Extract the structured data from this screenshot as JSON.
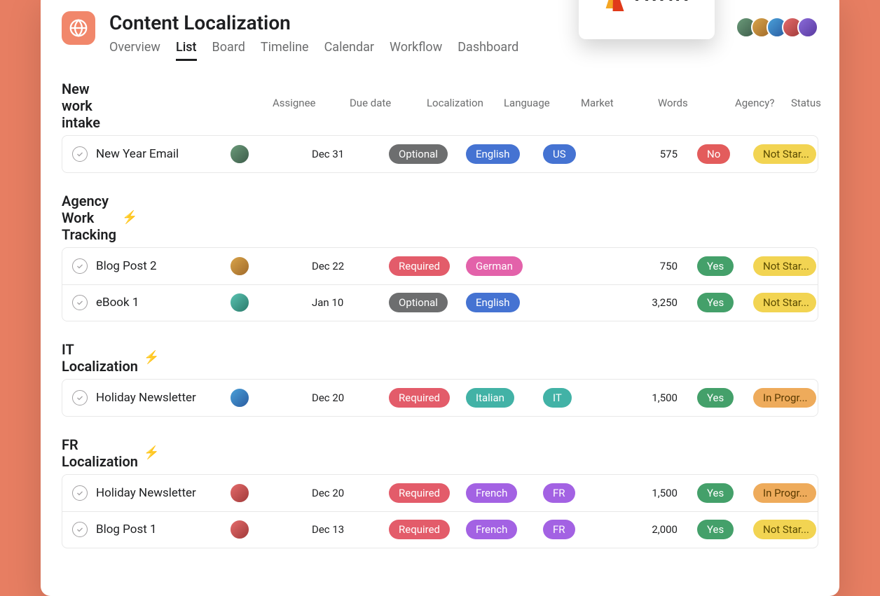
{
  "brand": {
    "name": "AWIN"
  },
  "project": {
    "title": "Content Localization",
    "tabs": [
      "Overview",
      "List",
      "Board",
      "Timeline",
      "Calendar",
      "Workflow",
      "Dashboard"
    ],
    "active_tab": "List"
  },
  "columns": [
    "Assignee",
    "Due date",
    "Localization",
    "Language",
    "Market",
    "Words",
    "Agency?",
    "Status"
  ],
  "sections": [
    {
      "title": "New work intake",
      "bolt": false,
      "tasks": [
        {
          "name": "New Year Email",
          "assignee_class": "a1",
          "due": "Dec 31",
          "localization": {
            "label": "Optional",
            "color": "dark"
          },
          "language": {
            "label": "English",
            "color": "blue"
          },
          "market": {
            "label": "US",
            "color": "blue"
          },
          "words": "575",
          "agency": {
            "label": "No",
            "color": "redno"
          },
          "status": {
            "label": "Not Star...",
            "color": "yellow"
          }
        }
      ]
    },
    {
      "title": "Agency Work Tracking",
      "bolt": true,
      "tasks": [
        {
          "name": "Blog Post 2",
          "assignee_class": "a2",
          "due": "Dec 22",
          "localization": {
            "label": "Required",
            "color": "red"
          },
          "language": {
            "label": "German",
            "color": "pink"
          },
          "market": null,
          "words": "750",
          "agency": {
            "label": "Yes",
            "color": "green"
          },
          "status": {
            "label": "Not Star...",
            "color": "yellow"
          }
        },
        {
          "name": "eBook 1",
          "assignee_class": "a6",
          "due": "Jan 10",
          "localization": {
            "label": "Optional",
            "color": "dark"
          },
          "language": {
            "label": "English",
            "color": "blue"
          },
          "market": null,
          "words": "3,250",
          "agency": {
            "label": "Yes",
            "color": "green"
          },
          "status": {
            "label": "Not Star...",
            "color": "yellow"
          }
        }
      ]
    },
    {
      "title": "IT Localization",
      "bolt": true,
      "tasks": [
        {
          "name": "Holiday Newsletter",
          "assignee_class": "a3",
          "due": "Dec 20",
          "localization": {
            "label": "Required",
            "color": "red"
          },
          "language": {
            "label": "Italian",
            "color": "teal"
          },
          "market": {
            "label": "IT",
            "color": "teal"
          },
          "words": "1,500",
          "agency": {
            "label": "Yes",
            "color": "green"
          },
          "status": {
            "label": "In Progr...",
            "color": "orange"
          }
        }
      ]
    },
    {
      "title": "FR Localization",
      "bolt": true,
      "tasks": [
        {
          "name": "Holiday Newsletter",
          "assignee_class": "a4",
          "due": "Dec 20",
          "localization": {
            "label": "Required",
            "color": "red"
          },
          "language": {
            "label": "French",
            "color": "purple"
          },
          "market": {
            "label": "FR",
            "color": "purple"
          },
          "words": "1,500",
          "agency": {
            "label": "Yes",
            "color": "green"
          },
          "status": {
            "label": "In Progr...",
            "color": "orange"
          }
        },
        {
          "name": "Blog Post 1",
          "assignee_class": "a4",
          "due": "Dec 13",
          "localization": {
            "label": "Required",
            "color": "red"
          },
          "language": {
            "label": "French",
            "color": "purple"
          },
          "market": {
            "label": "FR",
            "color": "purple"
          },
          "words": "2,000",
          "agency": {
            "label": "Yes",
            "color": "green"
          },
          "status": {
            "label": "Not Star...",
            "color": "yellow"
          }
        }
      ]
    }
  ],
  "collaborators": [
    "a1",
    "a2",
    "a3",
    "a4",
    "a5"
  ]
}
